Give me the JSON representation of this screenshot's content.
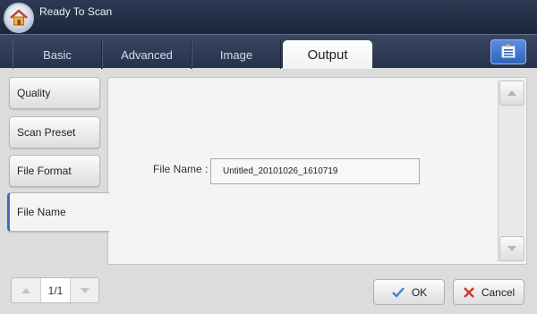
{
  "header": {
    "title": "Ready To Scan"
  },
  "tabs": [
    {
      "label": "Basic"
    },
    {
      "label": "Advanced"
    },
    {
      "label": "Image"
    },
    {
      "label": "Output"
    }
  ],
  "sidebar": {
    "items": [
      {
        "label": "Quality"
      },
      {
        "label": "Scan Preset"
      },
      {
        "label": "File Format"
      },
      {
        "label": "File Name"
      }
    ]
  },
  "main": {
    "field_label": "File Name :",
    "field_value": "Untitled_20101026_1610719"
  },
  "pager": {
    "text": "1/1"
  },
  "actions": {
    "ok_label": "OK",
    "cancel_label": "Cancel"
  },
  "colors": {
    "header_bg": "#1d2639",
    "active_item_accent": "#3d6fb6",
    "ok_check": "#3f7fd9",
    "cancel_x": "#d9342b"
  },
  "icons": {
    "home": "home-icon",
    "menu": "list-menu-icon",
    "ok": "check-icon",
    "cancel": "close-icon",
    "scroll_up": "chevron-up-icon",
    "scroll_down": "chevron-down-icon"
  }
}
